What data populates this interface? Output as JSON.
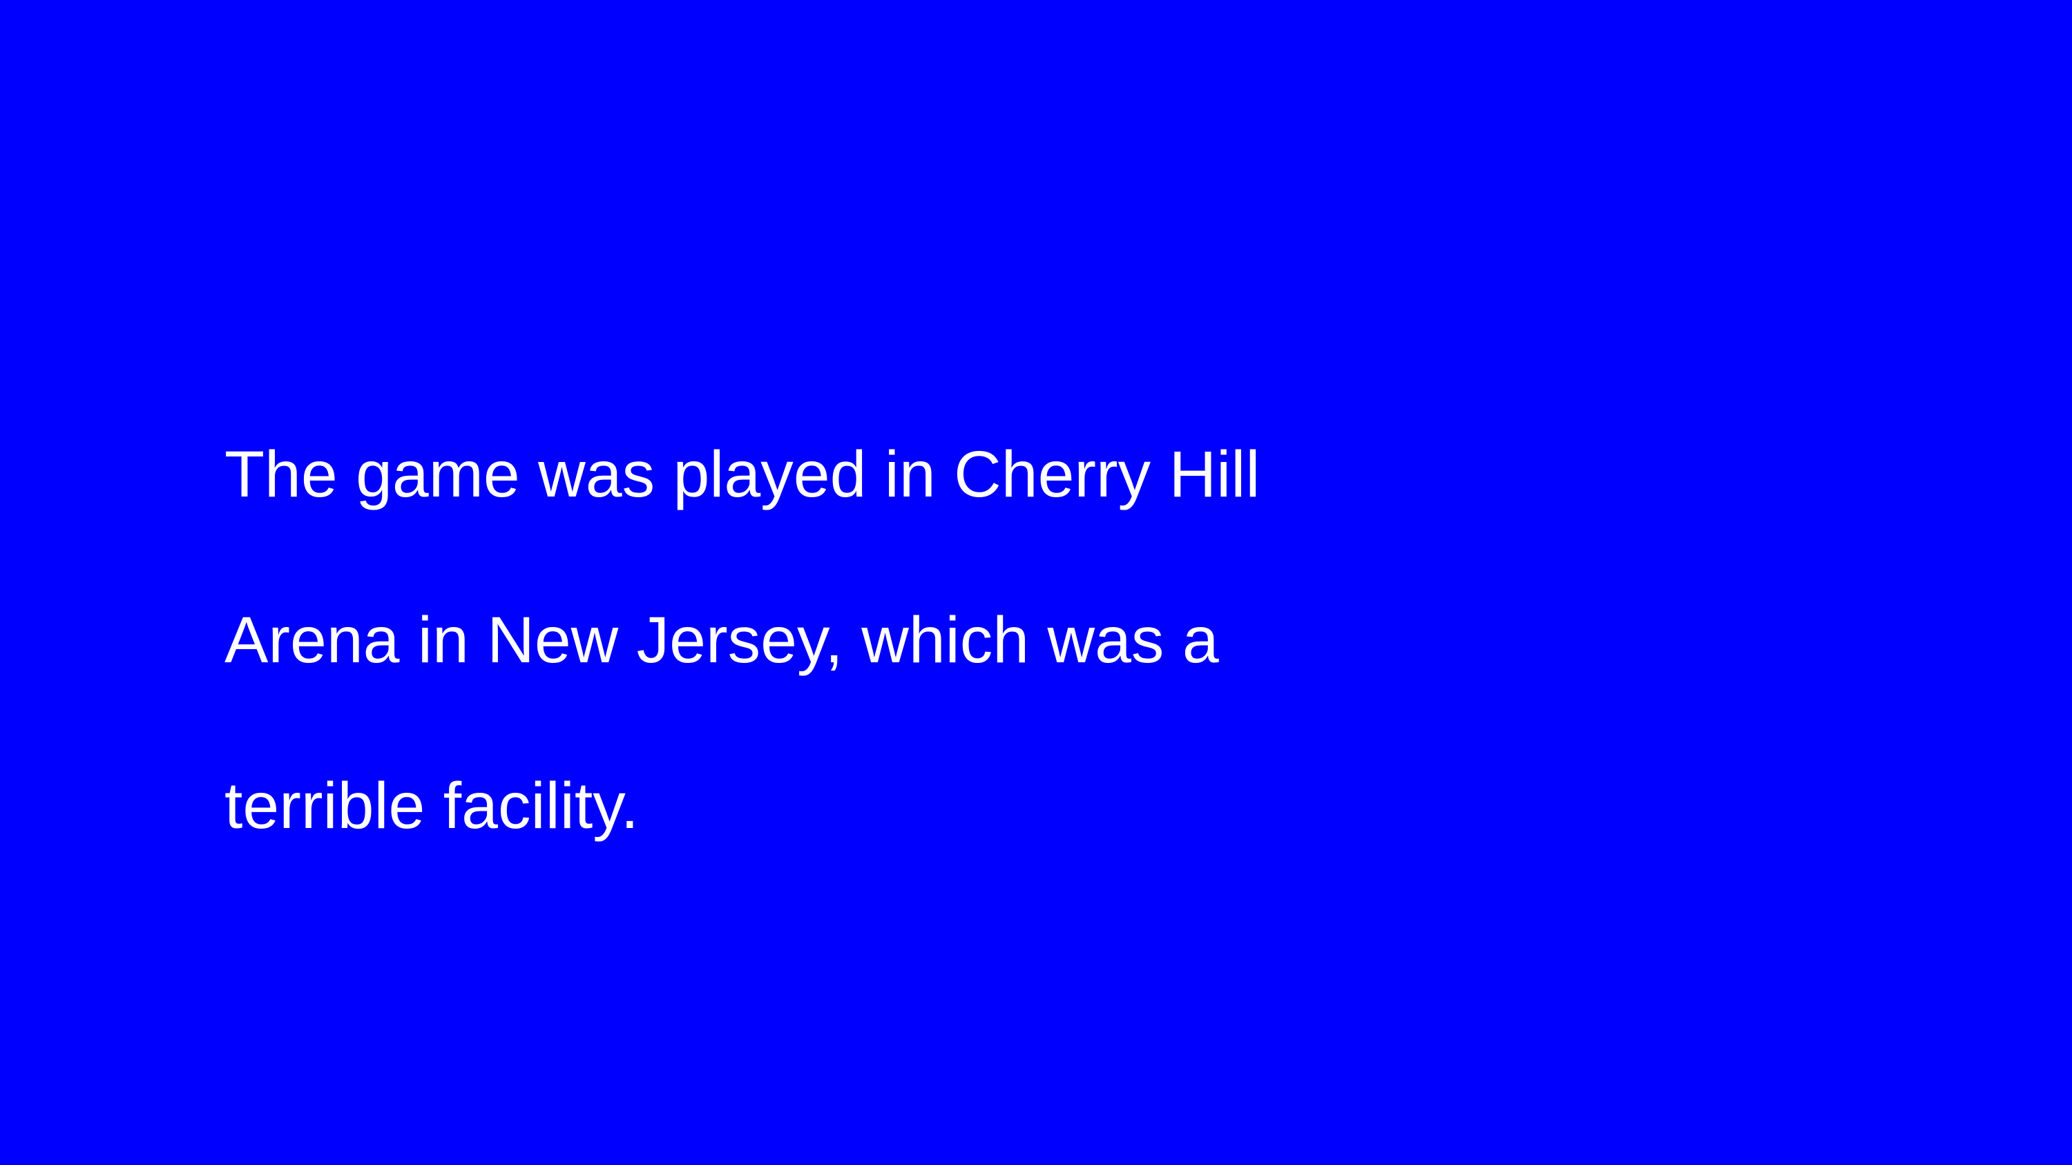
{
  "slide": {
    "background_color": "#0000ff",
    "text_color": "#ffffff",
    "lines": [
      "The game was played in Cherry Hill",
      "Arena in New Jersey, which was a",
      "terrible facility."
    ]
  }
}
